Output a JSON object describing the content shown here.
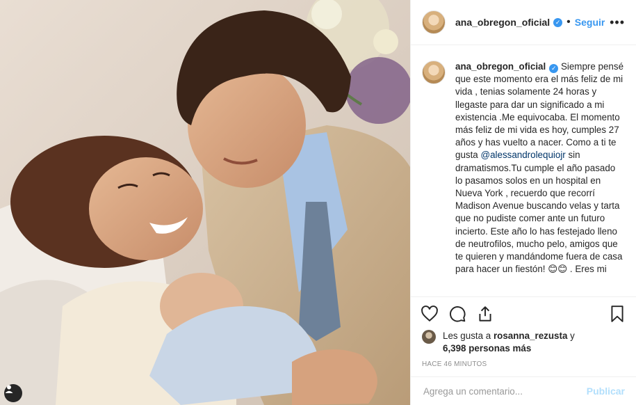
{
  "post": {
    "username": "ana_obregon_oficial",
    "follow_label": "Seguir",
    "more_label": "•••",
    "verified_glyph": "✓",
    "caption": {
      "part1": "Siempre pensé que este momento era el más feliz de mi vida , tenias solamente 24 horas y llegaste para dar un significado a mi existencia .Me equivocaba. El momento más feliz de mi vida es hoy, cumples 27 años y has vuelto a nacer. Como a ti te gusta ",
      "mention": "@alessandrolequiojr",
      "part2": " sin dramatismos.Tu cumple el año pasado lo pasamos solos en un hospital en Nueva York , recuerdo que recorrí Madison Avenue buscando velas y tarta que no pudiste comer ante un futuro incierto. Este año lo has festejado lleno de neutrofilos, mucho pelo, amigos que te quieren y mandándome fuera de casa para hacer un fiestón! 😊😊 . Eres mi"
    },
    "likes": {
      "prefix": "Les gusta a ",
      "user": "rosanna_rezusta",
      "middle": " y",
      "count": "6,398 personas más"
    },
    "time_ago": "HACE 46 MINUTOS",
    "comment_placeholder": "Agrega un comentario...",
    "publish_label": "Publicar"
  },
  "icons": {
    "like": "heart-icon",
    "comment": "comment-icon",
    "share": "share-icon",
    "save": "bookmark-icon",
    "tag": "user-tag-icon"
  },
  "colors": {
    "link": "#3897f0",
    "mention": "#003569",
    "publish_disabled": "#b2dffc",
    "muted": "#8e8e8e"
  }
}
